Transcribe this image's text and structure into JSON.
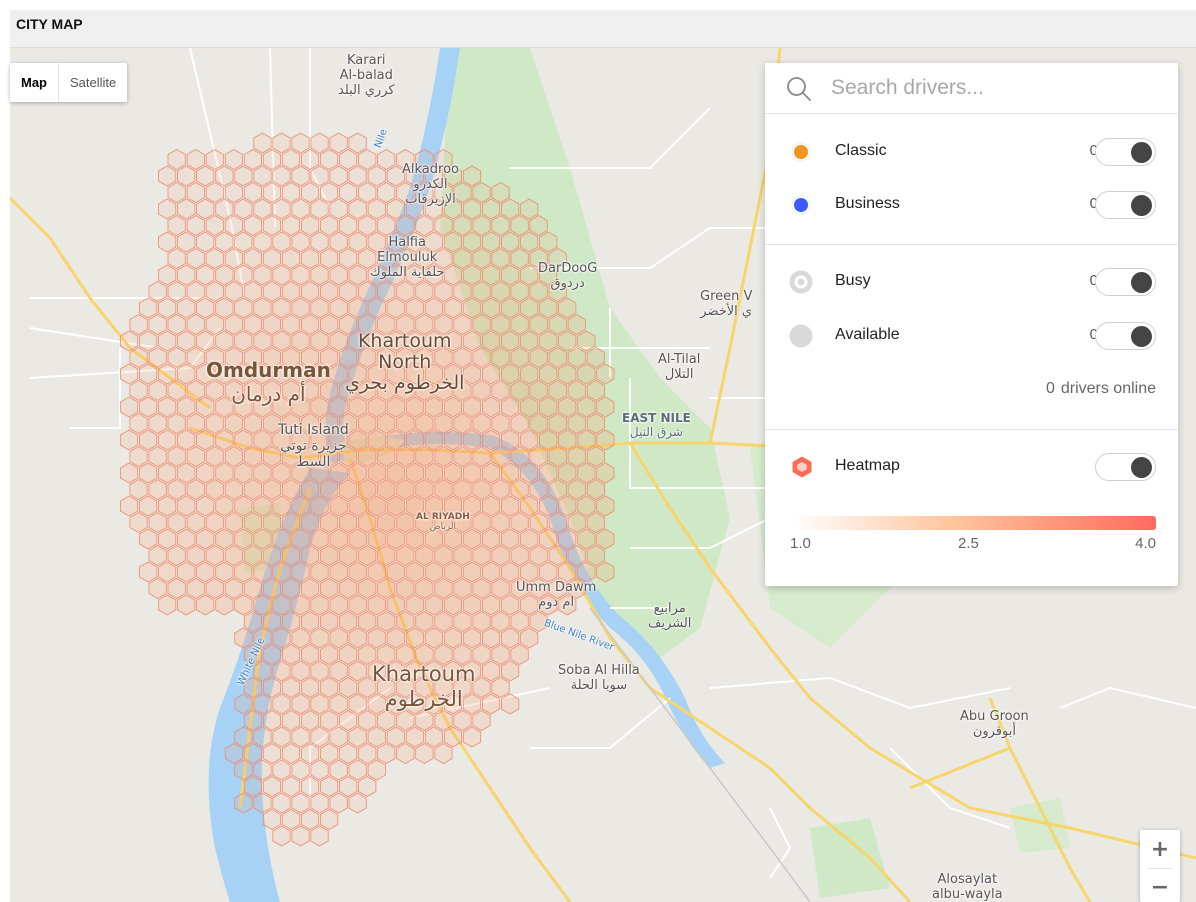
{
  "header": {
    "title": "CITY MAP"
  },
  "map": {
    "type_buttons": [
      {
        "label": "Map",
        "active": true
      },
      {
        "label": "Satellite",
        "active": false
      }
    ],
    "labels": {
      "karari": "Karari",
      "albalad": "Al-balad",
      "albalad_ar": "كرري البلد",
      "nile": "Nile",
      "alkadroo": "Alkadroo",
      "alkadroo_ar": "الكدرو",
      "alzarqab_ar": "الإزيرقاب",
      "halfia": "Halfia",
      "elmouluk": "Elmouluk",
      "halfia_ar": "حلفاية الملوك",
      "dardoog": "DarDooG",
      "dardoog_ar": "دردوق",
      "green_v": "Green V",
      "green_v_ar": "ي الأخضر",
      "khartoum_north": "Khartoum",
      "khartoum_north_2": "North",
      "khartoum_north_ar": "الخرطوم بحري",
      "omdurman": "Omdurman",
      "omdurman_ar": "أم درمان",
      "altilal": "Al-Tilal",
      "altilal_ar": "التلال",
      "east_nile": "EAST NILE",
      "east_nile_ar": "شرق النيل",
      "tuti": "Tuti Island",
      "tuti_ar": "جزيرة توتي",
      "alsait_ar": "السط",
      "alriyadh": "AL RIYADH",
      "alriyadh_ar": "الرياض",
      "umm_dawm": "Umm Dawm",
      "umm_dawm_ar": "ام دوم",
      "marabie_ar": "مرابيع",
      "alsharif_ar": "الشريف",
      "blue_nile": "Blue Nile River",
      "white_nile": "White Nile",
      "khartoum": "Khartoum",
      "khartoum_ar": "الخرطوم",
      "soba": "Soba Al Hilla",
      "soba_ar": "سوبا الحلة",
      "abu_groon": "Abu Groon",
      "abu_groon_ar": "أبوقرون",
      "alosaylat": "Alosaylat",
      "albuwayla": "albu-wayla"
    },
    "zoom_in": "+",
    "zoom_out": "−",
    "colors": {
      "land": "#ebe9e4",
      "green": "#cfe8c6",
      "water": "#a8d2f5",
      "road": "#f7d56b",
      "hex_stroke": "#f08a6e"
    }
  },
  "panel": {
    "search_placeholder": "Search drivers...",
    "car_types": [
      {
        "label": "Classic",
        "count": "0",
        "color": "#f7941d"
      },
      {
        "label": "Business",
        "count": "0",
        "color": "#3d5afe"
      }
    ],
    "statuses": [
      {
        "label": "Busy",
        "count": "0",
        "icon": "busy-ring-icon"
      },
      {
        "label": "Available",
        "count": "0",
        "icon": "available-dot-icon"
      }
    ],
    "online_count": "0",
    "online_text": "drivers online",
    "heatmap": {
      "label": "Heatmap",
      "icon": "hexagon-icon",
      "color": "#ff6b57"
    },
    "scale": {
      "min": "1.0",
      "mid": "2.5",
      "max": "4.0"
    }
  }
}
